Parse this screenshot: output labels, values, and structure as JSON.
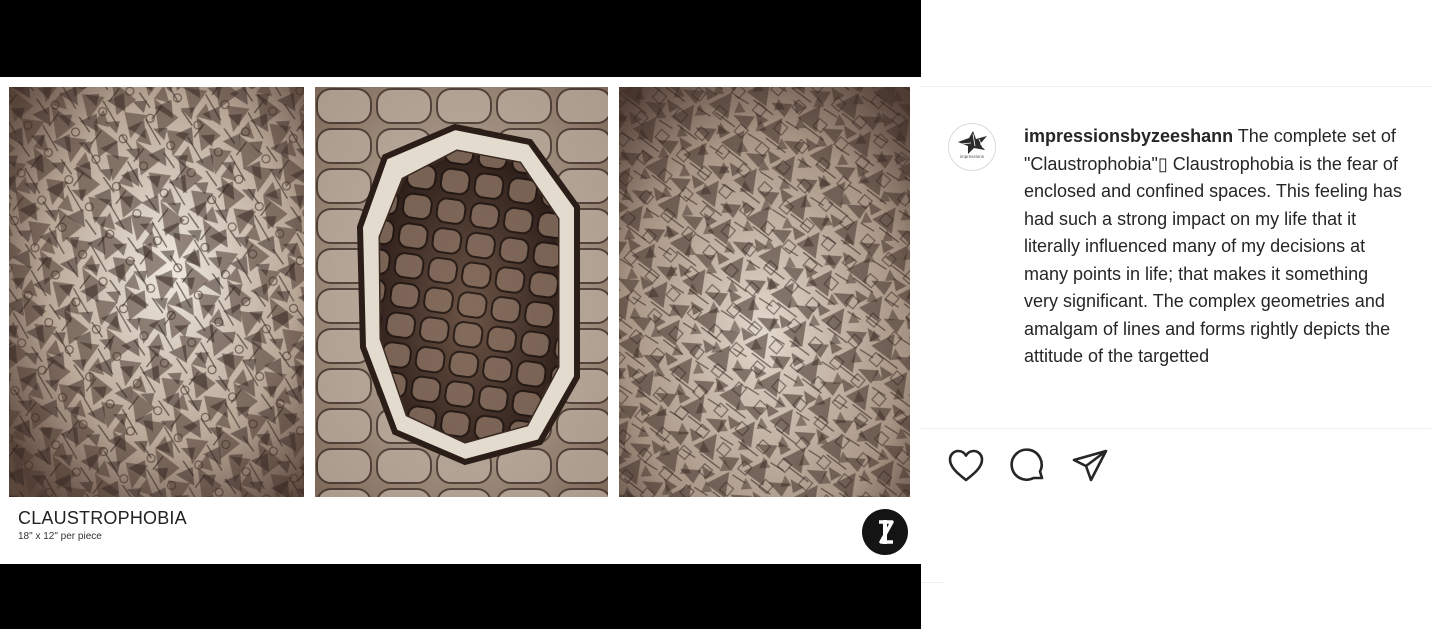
{
  "post": {
    "artwork": {
      "title": "CLAUSTROPHOBIA",
      "size": "18\" x 12\" per piece",
      "logo_letter": "Z",
      "panels": [
        "chaotic-geometry-left",
        "enclosed-cocoon-center",
        "chaotic-geometry-right"
      ]
    },
    "username": "impressionsbyzeeshann",
    "caption_text": "The complete set of \"Claustrophobia\"▯ Claustrophobia is the fear of enclosed and confined spaces. This feeling has had such a strong impact on my life that it literally influenced many of my decisions at many points in life; that makes it something very significant. The complex geometries and amalgam of lines and forms rightly depicts the attitude of the targetted",
    "avatar_text": "impressions",
    "actions": {
      "like": "heart-icon",
      "comment": "comment-icon",
      "share": "paper-plane-icon"
    }
  },
  "colors": {
    "media_background": "#000000",
    "text": "#262626",
    "divider": "#efefef",
    "sepia_light": "#d9d0c3",
    "sepia_dark": "#3a2a22"
  }
}
